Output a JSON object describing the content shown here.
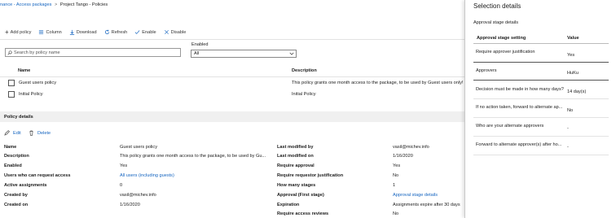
{
  "breadcrumb": {
    "part1": "nance - Access packages",
    "sep1": ">",
    "part2": "Project Tango - Policies"
  },
  "toolbar": {
    "add_policy": "Add policy",
    "column": "Column",
    "download": "Download",
    "refresh": "Refresh",
    "enable": "Enable",
    "disable": "Disable"
  },
  "search": {
    "placeholder": "Search by policy name"
  },
  "filter": {
    "label": "Enabled",
    "value": "All"
  },
  "table": {
    "headers": {
      "name": "Name",
      "description": "Description"
    },
    "rows": [
      {
        "name": "Guest users policy",
        "description": "This policy grants one month access to the package, to be used by Guest users only!"
      },
      {
        "name": "Initial Policy",
        "description": "Initial Policy"
      }
    ]
  },
  "policy_details": {
    "title": "Policy details",
    "edit": "Edit",
    "delete": "Delete",
    "left": [
      {
        "label": "Name",
        "value": "Guest users policy"
      },
      {
        "label": "Description",
        "value": "This policy grants one month access to the package, to be used by Gu..."
      },
      {
        "label": "Enabled",
        "value": "Yes"
      },
      {
        "label": "Users who can request access",
        "value": "All users (including guests)"
      },
      {
        "label": "Active assignments",
        "value": "0"
      },
      {
        "label": "Created by",
        "value": "vasil@michev.info"
      },
      {
        "label": "Created on",
        "value": "1/16/2020"
      }
    ],
    "right": [
      {
        "label": "Last modified by",
        "value": "vasil@michev.info"
      },
      {
        "label": "Last modified on",
        "value": "1/16/2020"
      },
      {
        "label": "Require approval",
        "value": "Yes"
      },
      {
        "label": "Require requestor justification",
        "value": "No"
      },
      {
        "label": "How many stages",
        "value": "1"
      },
      {
        "label": "Approval (First stage)",
        "value": "Approval stage details"
      },
      {
        "label": "Expiration",
        "value": "Assignments expire after 30 days"
      },
      {
        "label": "Require access reviews",
        "value": "No"
      }
    ]
  },
  "selection": {
    "title": "Selection details",
    "subtitle": "Approval stage details",
    "col_setting": "Approval stage setting",
    "col_value": "Value",
    "rows": [
      {
        "setting": "Require approver justification",
        "value": "Yes"
      },
      {
        "setting": "Approvers",
        "value": "HuKu"
      },
      {
        "setting": "Decision must be made in how many days?",
        "value": "14 day(s)"
      },
      {
        "setting": "If no action taken, forward to alternate ap...",
        "value": "No"
      },
      {
        "setting": "Who are your alternate approvers",
        "value": "-"
      },
      {
        "setting": "Forward to alternate approver(s) after ho...",
        "value": "-"
      }
    ]
  },
  "colors": {
    "link": "#1565c0",
    "panel_border": "#c8c8c8",
    "section_bg": "#f0f0f0"
  }
}
